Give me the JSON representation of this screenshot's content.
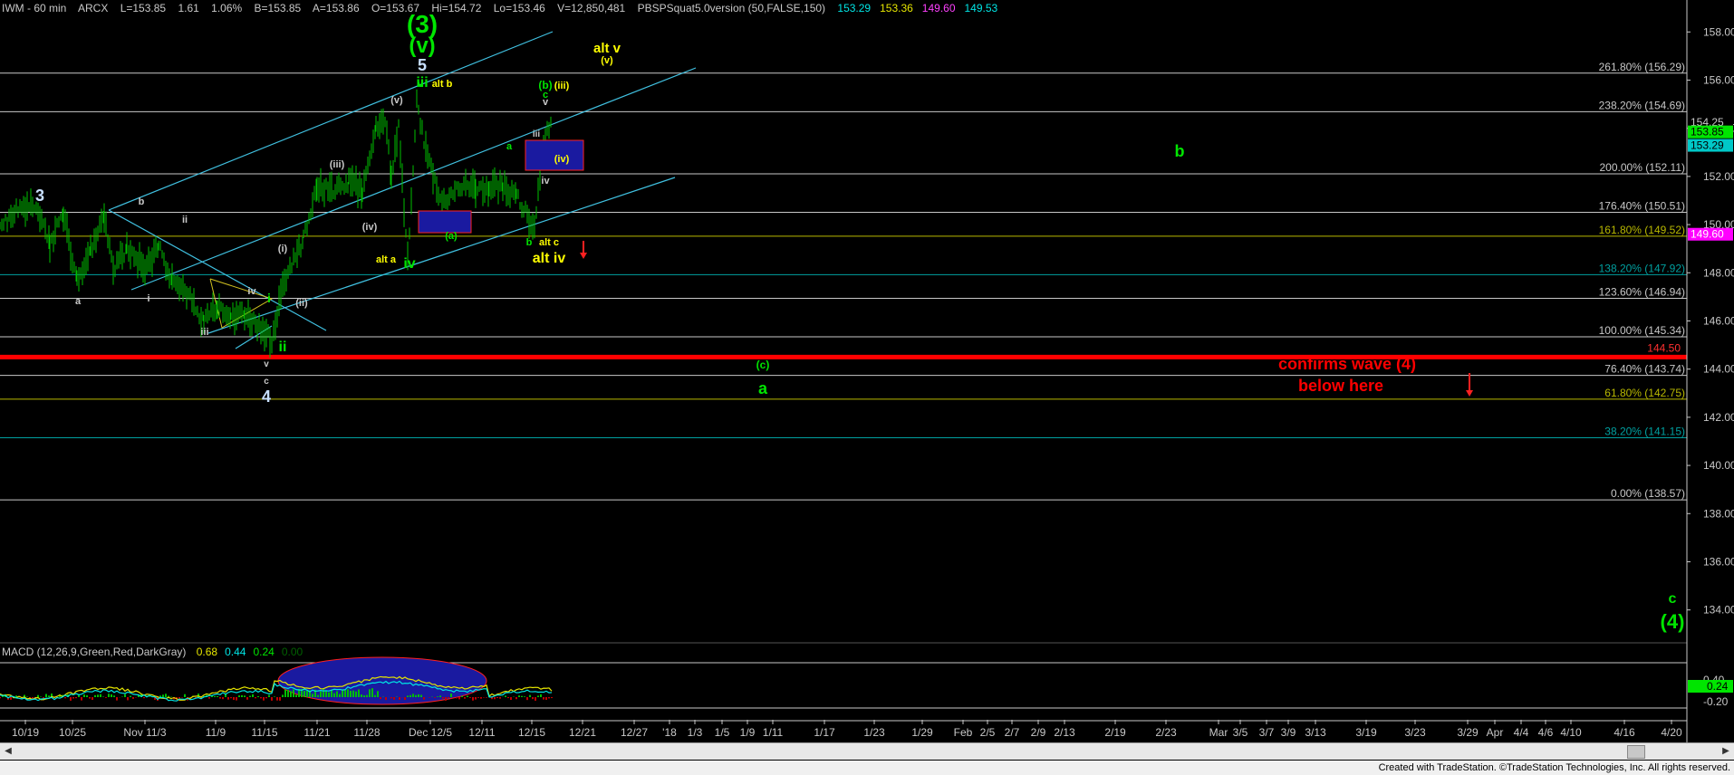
{
  "header": {
    "symbol": "IWM - 60 min",
    "exchange": "ARCX",
    "last": "L=153.85",
    "change": "1.61",
    "change_pct": "1.06%",
    "bid": "B=153.85",
    "ask": "A=153.86",
    "open": "O=153.67",
    "high": "Hi=154.72",
    "low": "Lo=153.46",
    "volume": "V=12,850,481",
    "study": "PBSPSquat5.0version (50,FALSE,150)",
    "study_values": [
      {
        "text": "153.29",
        "color": "#00e5e5"
      },
      {
        "text": "153.36",
        "color": "#e5e500"
      },
      {
        "text": "149.60",
        "color": "#ff40ff"
      },
      {
        "text": "149.53",
        "color": "#00e5e5"
      }
    ]
  },
  "macd_header": {
    "label": "MACD (12,26,9,Green,Red,DarkGray)",
    "values": [
      {
        "text": "0.68",
        "color": "#e5e500"
      },
      {
        "text": "0.44",
        "color": "#00e5e5"
      },
      {
        "text": "0.24",
        "color": "#00e500"
      },
      {
        "text": "0.00",
        "color": "#006000"
      }
    ]
  },
  "footer": {
    "credit": "Created with TradeStation. ©TradeStation Technologies, Inc. All rights reserved."
  },
  "chart_data": {
    "type": "line",
    "title": "IWM - 60 min",
    "ylim": [
      133,
      159
    ],
    "y_ticks": [
      "158.00",
      "156.00",
      "154.00",
      "152.00",
      "150.00",
      "148.00",
      "146.00",
      "144.00",
      "142.00",
      "140.00",
      "138.00",
      "136.00",
      "134.00"
    ],
    "x_ticks": [
      "10/19",
      "10/25",
      "Nov 11/3",
      "11/9",
      "11/15",
      "11/21",
      "11/28",
      "Dec 12/5",
      "12/11",
      "12/15",
      "12/21",
      "12/27",
      "'18",
      "1/3",
      "1/5",
      "1/9",
      "1/11",
      "1/17",
      "1/23",
      "1/29",
      "Feb",
      "2/5",
      "2/7",
      "2/9",
      "2/13",
      "2/19",
      "2/23",
      "Mar",
      "3/5",
      "3/7",
      "3/9",
      "3/13",
      "3/19",
      "3/23",
      "3/29",
      "Apr",
      "4/4",
      "4/6",
      "4/10",
      "4/16",
      "4/20"
    ],
    "fib_levels": [
      {
        "label": "261.80% (156.29)",
        "value": 156.29,
        "color": "#c8c8c8"
      },
      {
        "label": "238.20% (154.69)",
        "value": 154.69,
        "color": "#c8c8c8"
      },
      {
        "label": "200.00% (152.11)",
        "value": 152.11,
        "color": "#c8c8c8"
      },
      {
        "label": "176.40% (150.51)",
        "value": 150.51,
        "color": "#c8c8c8"
      },
      {
        "label": "161.80% (149.52)",
        "value": 149.52,
        "color": "#b8b800"
      },
      {
        "label": "138.20% (147.92)",
        "value": 147.92,
        "color": "#00a0a0"
      },
      {
        "label": "123.60% (146.94)",
        "value": 146.94,
        "color": "#c8c8c8"
      },
      {
        "label": "100.00% (145.34)",
        "value": 145.34,
        "color": "#c8c8c8"
      },
      {
        "label": "76.40% (143.74)",
        "value": 143.74,
        "color": "#c8c8c8"
      },
      {
        "label": "61.80% (142.75)",
        "value": 142.75,
        "color": "#b8b800"
      },
      {
        "label": "38.20% (141.15)",
        "value": 141.15,
        "color": "#00a0a0"
      },
      {
        "label": "0.00% (138.57)",
        "value": 138.57,
        "color": "#c8c8c8"
      }
    ],
    "support_line": {
      "value": 144.5,
      "label": "144.50",
      "color": "#ff0000"
    },
    "price_tags": [
      {
        "text": "154.25",
        "value": 154.25,
        "bg": "#000000",
        "fg": "#c8c8c8"
      },
      {
        "text": "153.85",
        "value": 153.85,
        "bg": "#00e500",
        "fg": "#000000"
      },
      {
        "text": "153.29",
        "value": 153.29,
        "bg": "#00c8c8",
        "fg": "#000000"
      },
      {
        "text": "149.60",
        "value": 149.6,
        "bg": "#ff00ff",
        "fg": "#ffffff"
      }
    ],
    "macd_ticks": [
      "0.40",
      "0.24",
      "-0.20"
    ],
    "price_series": {
      "name": "IWM",
      "x": [
        "10/19",
        "10/25",
        "11/3",
        "11/9",
        "11/13",
        "11/15",
        "11/21",
        "11/28",
        "12/1",
        "12/5",
        "12/11",
        "12/15",
        "12/18"
      ],
      "values": [
        150.0,
        148.0,
        149.5,
        146.5,
        146.0,
        145.5,
        150.5,
        153.0,
        152.0,
        150.5,
        151.5,
        150.0,
        154.2
      ]
    },
    "annotations": [
      {
        "text": "(3)",
        "color": "#00e500"
      },
      {
        "text": "(v)",
        "color": "#00e500"
      },
      {
        "text": "5",
        "color": "#c8e0ff"
      },
      {
        "text": "alt v",
        "color": "#ffff00"
      },
      {
        "text": "(v)",
        "color": "#ffff00"
      },
      {
        "text": "iii",
        "color": "#00e500"
      },
      {
        "text": "v",
        "color": "#00e500"
      },
      {
        "text": "alt b",
        "color": "#ffff00"
      },
      {
        "text": "(b)",
        "color": "#00e500"
      },
      {
        "text": "(iii)",
        "color": "#ffff00"
      },
      {
        "text": "c",
        "color": "#00e500"
      },
      {
        "text": "v",
        "color": "#c8c8c8"
      },
      {
        "text": "(v)",
        "color": "#c8c8c8"
      },
      {
        "text": "iii",
        "color": "#c8c8c8"
      },
      {
        "text": "(iv)",
        "color": "#ffff00"
      },
      {
        "text": "iv",
        "color": "#c8c8c8"
      },
      {
        "text": "a",
        "color": "#00e500"
      },
      {
        "text": "b",
        "color": "#00e500"
      },
      {
        "text": "3",
        "color": "#c8e0ff"
      },
      {
        "text": "b",
        "color": "#c8c8c8"
      },
      {
        "text": "ii",
        "color": "#c8c8c8"
      },
      {
        "text": "(iii)",
        "color": "#c8c8c8"
      },
      {
        "text": "(iv)",
        "color": "#c8c8c8"
      },
      {
        "text": "(a)",
        "color": "#00e500"
      },
      {
        "text": "b",
        "color": "#00e500"
      },
      {
        "text": "alt c",
        "color": "#ffff00"
      },
      {
        "text": "alt iv",
        "color": "#ffff00"
      },
      {
        "text": "alt a",
        "color": "#ffff00"
      },
      {
        "text": "iv",
        "color": "#00e500"
      },
      {
        "text": "(i)",
        "color": "#c8c8c8"
      },
      {
        "text": "i",
        "color": "#00e500"
      },
      {
        "text": "iv",
        "color": "#c8c8c8"
      },
      {
        "text": "(ii)",
        "color": "#c8c8c8"
      },
      {
        "text": "a",
        "color": "#c8c8c8"
      },
      {
        "text": "i",
        "color": "#c8c8c8"
      },
      {
        "text": "iii",
        "color": "#c8c8c8"
      },
      {
        "text": "ii",
        "color": "#00e500"
      },
      {
        "text": "v",
        "color": "#c8c8c8"
      },
      {
        "text": "c",
        "color": "#c8c8c8"
      },
      {
        "text": "4",
        "color": "#c8e0ff"
      },
      {
        "text": "(c)",
        "color": "#00e500"
      },
      {
        "text": "a",
        "color": "#00e500"
      },
      {
        "text": "confirms wave (4)",
        "color": "#ff0000"
      },
      {
        "text": "below here",
        "color": "#ff0000"
      },
      {
        "text": "c",
        "color": "#00e500"
      },
      {
        "text": "(4)",
        "color": "#00e500"
      }
    ]
  }
}
